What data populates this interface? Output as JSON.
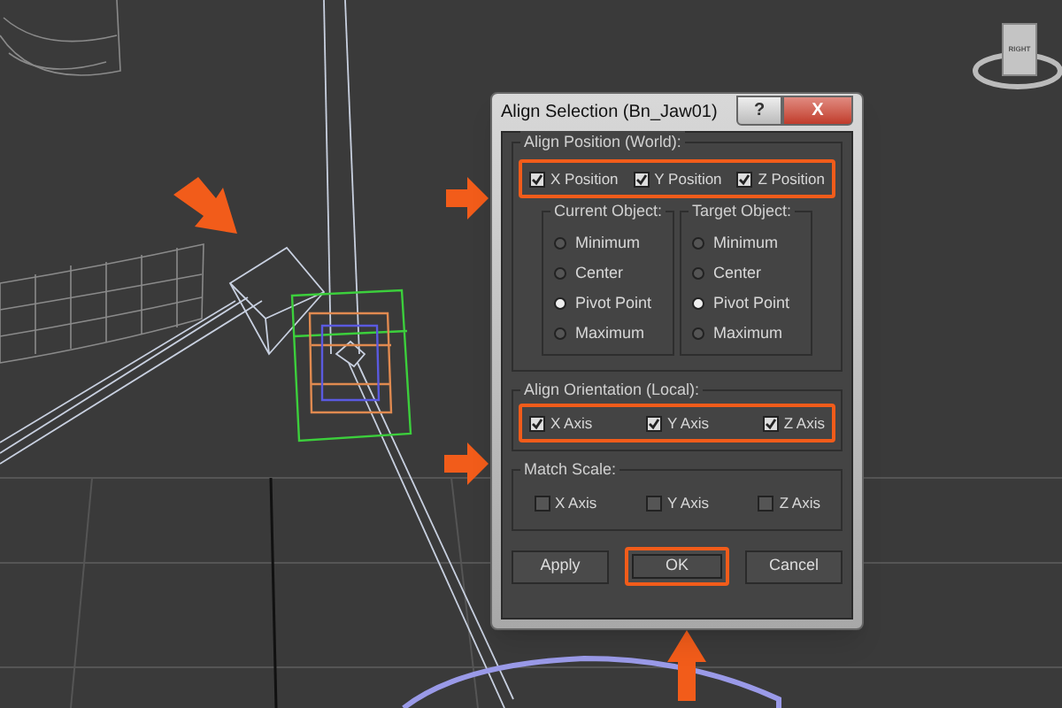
{
  "viewcube": {
    "label": "RIGHT"
  },
  "dialog": {
    "title": "Align Selection (Bn_Jaw01)",
    "title_buttons": [
      {
        "kind": "help",
        "label": "?"
      },
      {
        "kind": "close",
        "label": "X"
      }
    ],
    "position": {
      "label": "Align Position (World):",
      "highlighted": true,
      "checks": [
        {
          "label": "X Position",
          "checked": true
        },
        {
          "label": "Y Position",
          "checked": true
        },
        {
          "label": "Z Position",
          "checked": true
        }
      ],
      "subgroups": [
        {
          "label": "Current Object:",
          "options": [
            {
              "label": "Minimum",
              "selected": false
            },
            {
              "label": "Center",
              "selected": false
            },
            {
              "label": "Pivot Point",
              "selected": true
            },
            {
              "label": "Maximum",
              "selected": false
            }
          ]
        },
        {
          "label": "Target Object:",
          "options": [
            {
              "label": "Minimum",
              "selected": false
            },
            {
              "label": "Center",
              "selected": false
            },
            {
              "label": "Pivot Point",
              "selected": true
            },
            {
              "label": "Maximum",
              "selected": false
            }
          ]
        }
      ]
    },
    "orientation": {
      "label": "Align Orientation (Local):",
      "highlighted": true,
      "checks": [
        {
          "label": "X Axis",
          "checked": true
        },
        {
          "label": "Y Axis",
          "checked": true
        },
        {
          "label": "Z Axis",
          "checked": true
        }
      ]
    },
    "scale": {
      "label": "Match Scale:",
      "checks": [
        {
          "label": "X Axis",
          "checked": false
        },
        {
          "label": "Y Axis",
          "checked": false
        },
        {
          "label": "Z Axis",
          "checked": false
        }
      ]
    },
    "buttons": [
      {
        "label": "Apply",
        "highlighted": false
      },
      {
        "label": "OK",
        "highlighted": true
      },
      {
        "label": "Cancel",
        "highlighted": false
      }
    ]
  }
}
